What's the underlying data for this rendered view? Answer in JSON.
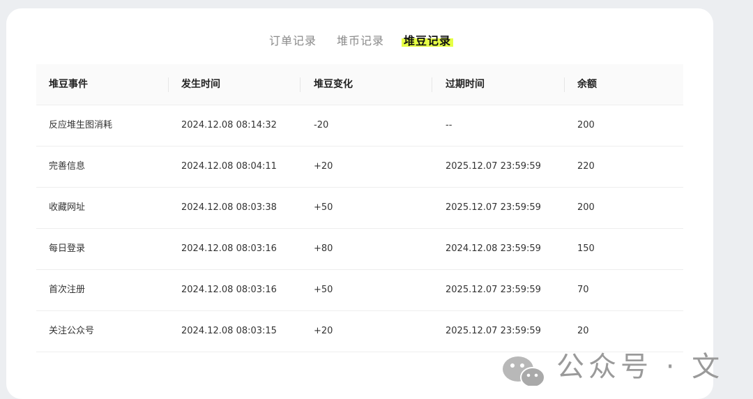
{
  "tabs": [
    {
      "label": "订单记录",
      "active": false
    },
    {
      "label": "堆币记录",
      "active": false
    },
    {
      "label": "堆豆记录",
      "active": true
    }
  ],
  "accent_color": "#e6ff45",
  "table": {
    "columns": [
      "堆豆事件",
      "发生时间",
      "堆豆变化",
      "过期时间",
      "余额"
    ],
    "rows": [
      {
        "event": "反应堆生图消耗",
        "time": "2024.12.08 08:14:32",
        "change": "-20",
        "expire": "--",
        "balance": "200"
      },
      {
        "event": "完善信息",
        "time": "2024.12.08 08:04:11",
        "change": "+20",
        "expire": "2025.12.07 23:59:59",
        "balance": "220"
      },
      {
        "event": "收藏网址",
        "time": "2024.12.08 08:03:38",
        "change": "+50",
        "expire": "2025.12.07 23:59:59",
        "balance": "200"
      },
      {
        "event": "每日登录",
        "time": "2024.12.08 08:03:16",
        "change": "+80",
        "expire": "2024.12.08 23:59:59",
        "balance": "150"
      },
      {
        "event": "首次注册",
        "time": "2024.12.08 08:03:16",
        "change": "+50",
        "expire": "2025.12.07 23:59:59",
        "balance": "70"
      },
      {
        "event": "关注公众号",
        "time": "2024.12.08 08:03:15",
        "change": "+20",
        "expire": "2025.12.07 23:59:59",
        "balance": "20"
      }
    ]
  },
  "watermark": {
    "text": "公众号 · 文"
  }
}
